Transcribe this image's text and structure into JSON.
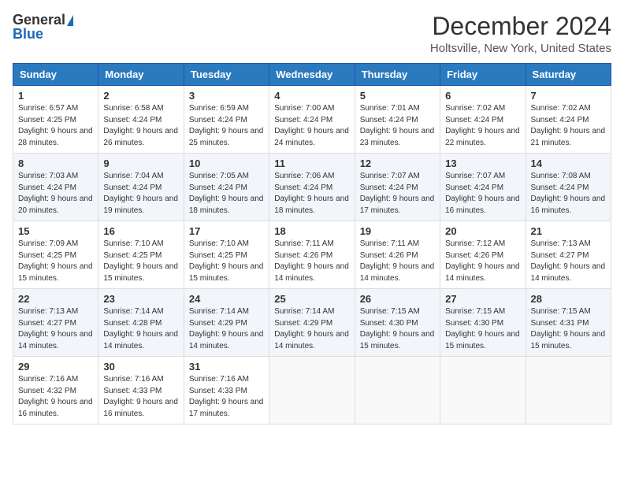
{
  "header": {
    "logo_general": "General",
    "logo_blue": "Blue",
    "title": "December 2024",
    "subtitle": "Holtsville, New York, United States"
  },
  "calendar": {
    "days_of_week": [
      "Sunday",
      "Monday",
      "Tuesday",
      "Wednesday",
      "Thursday",
      "Friday",
      "Saturday"
    ],
    "weeks": [
      [
        {
          "day": "1",
          "sunrise": "6:57 AM",
          "sunset": "4:25 PM",
          "daylight": "9 hours and 28 minutes."
        },
        {
          "day": "2",
          "sunrise": "6:58 AM",
          "sunset": "4:24 PM",
          "daylight": "9 hours and 26 minutes."
        },
        {
          "day": "3",
          "sunrise": "6:59 AM",
          "sunset": "4:24 PM",
          "daylight": "9 hours and 25 minutes."
        },
        {
          "day": "4",
          "sunrise": "7:00 AM",
          "sunset": "4:24 PM",
          "daylight": "9 hours and 24 minutes."
        },
        {
          "day": "5",
          "sunrise": "7:01 AM",
          "sunset": "4:24 PM",
          "daylight": "9 hours and 23 minutes."
        },
        {
          "day": "6",
          "sunrise": "7:02 AM",
          "sunset": "4:24 PM",
          "daylight": "9 hours and 22 minutes."
        },
        {
          "day": "7",
          "sunrise": "7:02 AM",
          "sunset": "4:24 PM",
          "daylight": "9 hours and 21 minutes."
        }
      ],
      [
        {
          "day": "8",
          "sunrise": "7:03 AM",
          "sunset": "4:24 PM",
          "daylight": "9 hours and 20 minutes."
        },
        {
          "day": "9",
          "sunrise": "7:04 AM",
          "sunset": "4:24 PM",
          "daylight": "9 hours and 19 minutes."
        },
        {
          "day": "10",
          "sunrise": "7:05 AM",
          "sunset": "4:24 PM",
          "daylight": "9 hours and 18 minutes."
        },
        {
          "day": "11",
          "sunrise": "7:06 AM",
          "sunset": "4:24 PM",
          "daylight": "9 hours and 18 minutes."
        },
        {
          "day": "12",
          "sunrise": "7:07 AM",
          "sunset": "4:24 PM",
          "daylight": "9 hours and 17 minutes."
        },
        {
          "day": "13",
          "sunrise": "7:07 AM",
          "sunset": "4:24 PM",
          "daylight": "9 hours and 16 minutes."
        },
        {
          "day": "14",
          "sunrise": "7:08 AM",
          "sunset": "4:24 PM",
          "daylight": "9 hours and 16 minutes."
        }
      ],
      [
        {
          "day": "15",
          "sunrise": "7:09 AM",
          "sunset": "4:25 PM",
          "daylight": "9 hours and 15 minutes."
        },
        {
          "day": "16",
          "sunrise": "7:10 AM",
          "sunset": "4:25 PM",
          "daylight": "9 hours and 15 minutes."
        },
        {
          "day": "17",
          "sunrise": "7:10 AM",
          "sunset": "4:25 PM",
          "daylight": "9 hours and 15 minutes."
        },
        {
          "day": "18",
          "sunrise": "7:11 AM",
          "sunset": "4:26 PM",
          "daylight": "9 hours and 14 minutes."
        },
        {
          "day": "19",
          "sunrise": "7:11 AM",
          "sunset": "4:26 PM",
          "daylight": "9 hours and 14 minutes."
        },
        {
          "day": "20",
          "sunrise": "7:12 AM",
          "sunset": "4:26 PM",
          "daylight": "9 hours and 14 minutes."
        },
        {
          "day": "21",
          "sunrise": "7:13 AM",
          "sunset": "4:27 PM",
          "daylight": "9 hours and 14 minutes."
        }
      ],
      [
        {
          "day": "22",
          "sunrise": "7:13 AM",
          "sunset": "4:27 PM",
          "daylight": "9 hours and 14 minutes."
        },
        {
          "day": "23",
          "sunrise": "7:14 AM",
          "sunset": "4:28 PM",
          "daylight": "9 hours and 14 minutes."
        },
        {
          "day": "24",
          "sunrise": "7:14 AM",
          "sunset": "4:29 PM",
          "daylight": "9 hours and 14 minutes."
        },
        {
          "day": "25",
          "sunrise": "7:14 AM",
          "sunset": "4:29 PM",
          "daylight": "9 hours and 14 minutes."
        },
        {
          "day": "26",
          "sunrise": "7:15 AM",
          "sunset": "4:30 PM",
          "daylight": "9 hours and 15 minutes."
        },
        {
          "day": "27",
          "sunrise": "7:15 AM",
          "sunset": "4:30 PM",
          "daylight": "9 hours and 15 minutes."
        },
        {
          "day": "28",
          "sunrise": "7:15 AM",
          "sunset": "4:31 PM",
          "daylight": "9 hours and 15 minutes."
        }
      ],
      [
        {
          "day": "29",
          "sunrise": "7:16 AM",
          "sunset": "4:32 PM",
          "daylight": "9 hours and 16 minutes."
        },
        {
          "day": "30",
          "sunrise": "7:16 AM",
          "sunset": "4:33 PM",
          "daylight": "9 hours and 16 minutes."
        },
        {
          "day": "31",
          "sunrise": "7:16 AM",
          "sunset": "4:33 PM",
          "daylight": "9 hours and 17 minutes."
        },
        null,
        null,
        null,
        null
      ]
    ]
  },
  "labels": {
    "sunrise": "Sunrise:",
    "sunset": "Sunset:",
    "daylight": "Daylight:"
  }
}
